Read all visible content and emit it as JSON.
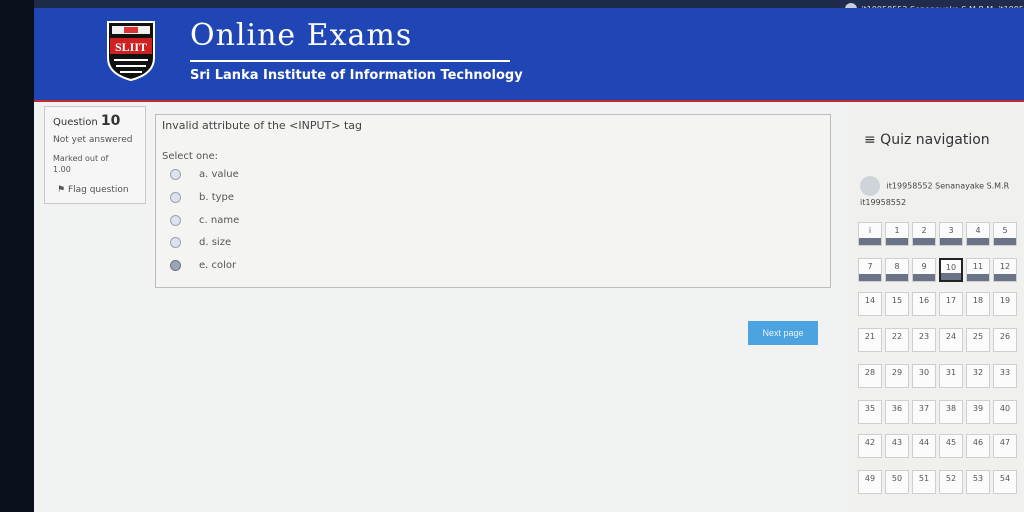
{
  "user_top": "it19958552 Senanayake S.M.R.M. it1995",
  "header": {
    "brand": "Online Exams",
    "subtitle": "Sri Lanka Institute of Information Technology",
    "logo_text": "SLIIT"
  },
  "question_info": {
    "label": "Question",
    "number": "10",
    "status": "Not yet answered",
    "marks_label": "Marked out of",
    "marks_value": "1.00",
    "flag_label": "Flag question"
  },
  "question": {
    "text": "Invalid attribute of the <INPUT> tag",
    "select_label": "Select one:",
    "options": [
      {
        "label": "a. value",
        "checked": false
      },
      {
        "label": "b. type",
        "checked": false
      },
      {
        "label": "c. name",
        "checked": false
      },
      {
        "label": "d. size",
        "checked": false
      },
      {
        "label": "e. color",
        "checked": true
      }
    ]
  },
  "next_button": "Next page",
  "quiz_nav": {
    "title": "≡ Quiz navigation",
    "user_name": "it19958552 Senanayake S.M.R",
    "user_id": "it19958552",
    "tiles": [
      [
        "i",
        "1",
        "2",
        "3",
        "4",
        "5"
      ],
      [
        "7",
        "8",
        "9",
        "10",
        "11",
        "12"
      ],
      [
        "14",
        "15",
        "16",
        "17",
        "18",
        "19"
      ],
      [
        "21",
        "22",
        "23",
        "24",
        "25",
        "26"
      ],
      [
        "28",
        "29",
        "30",
        "31",
        "32",
        "33"
      ],
      [
        "35",
        "36",
        "37",
        "38",
        "39",
        "40"
      ],
      [
        "42",
        "43",
        "44",
        "45",
        "46",
        "47"
      ],
      [
        "49",
        "50",
        "51",
        "52",
        "53",
        "54"
      ]
    ],
    "current": "10"
  }
}
